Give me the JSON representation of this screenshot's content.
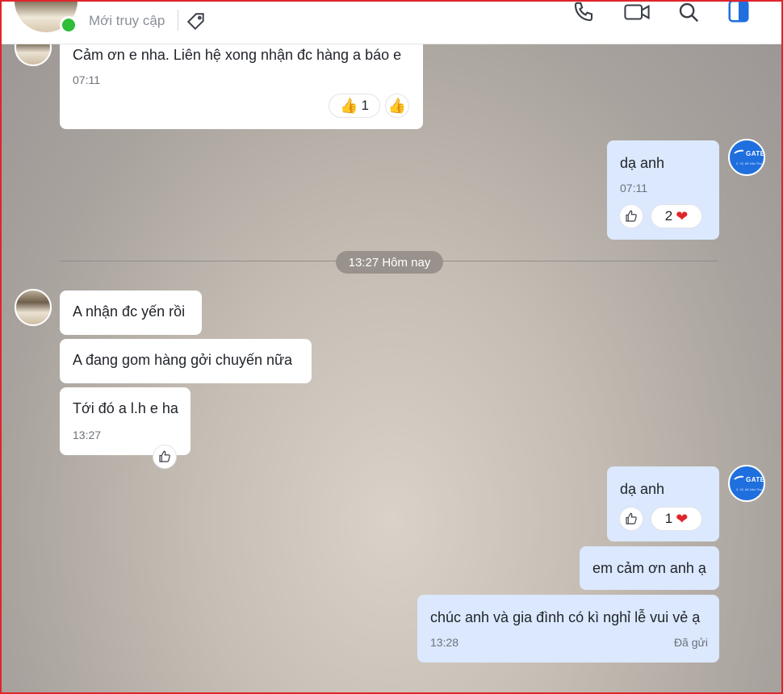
{
  "header": {
    "status": "Mới truy cập",
    "icons": [
      "tag-icon",
      "phone-icon",
      "video-icon",
      "search-icon",
      "sidebar-toggle-icon"
    ],
    "accent": "#1f6fde",
    "online_color": "#2fbd3a"
  },
  "self_avatar": {
    "brand": "GATEW",
    "sub": "0. 22, 66 Văn Thư"
  },
  "messages": [
    {
      "side": "in",
      "text": "Cảm ơn  e nha. Liên hệ xong nhận đc hàng a báo e",
      "time": "07:11",
      "reaction_count": "1"
    },
    {
      "side": "out",
      "text": "dạ anh",
      "time": "07:11",
      "reaction_count": "2"
    },
    {
      "side": "in",
      "text": "A nhận đc yến rồi"
    },
    {
      "side": "in",
      "text": "A đang gom hàng gởi chuyến nữa"
    },
    {
      "side": "in",
      "text": "Tới đó a l.h e ha",
      "time": "13:27"
    },
    {
      "side": "out",
      "text": "dạ anh",
      "reaction_count": "1"
    },
    {
      "side": "out",
      "text": "em cảm ơn anh ạ"
    },
    {
      "side": "out",
      "text": "chúc anh và gia đình có kì nghỉ lễ vui vẻ ạ",
      "time": "13:28",
      "status": "Đã gửi"
    }
  ],
  "divider": {
    "label": "13:27 Hôm nay"
  },
  "heart_color": "#e0242b"
}
